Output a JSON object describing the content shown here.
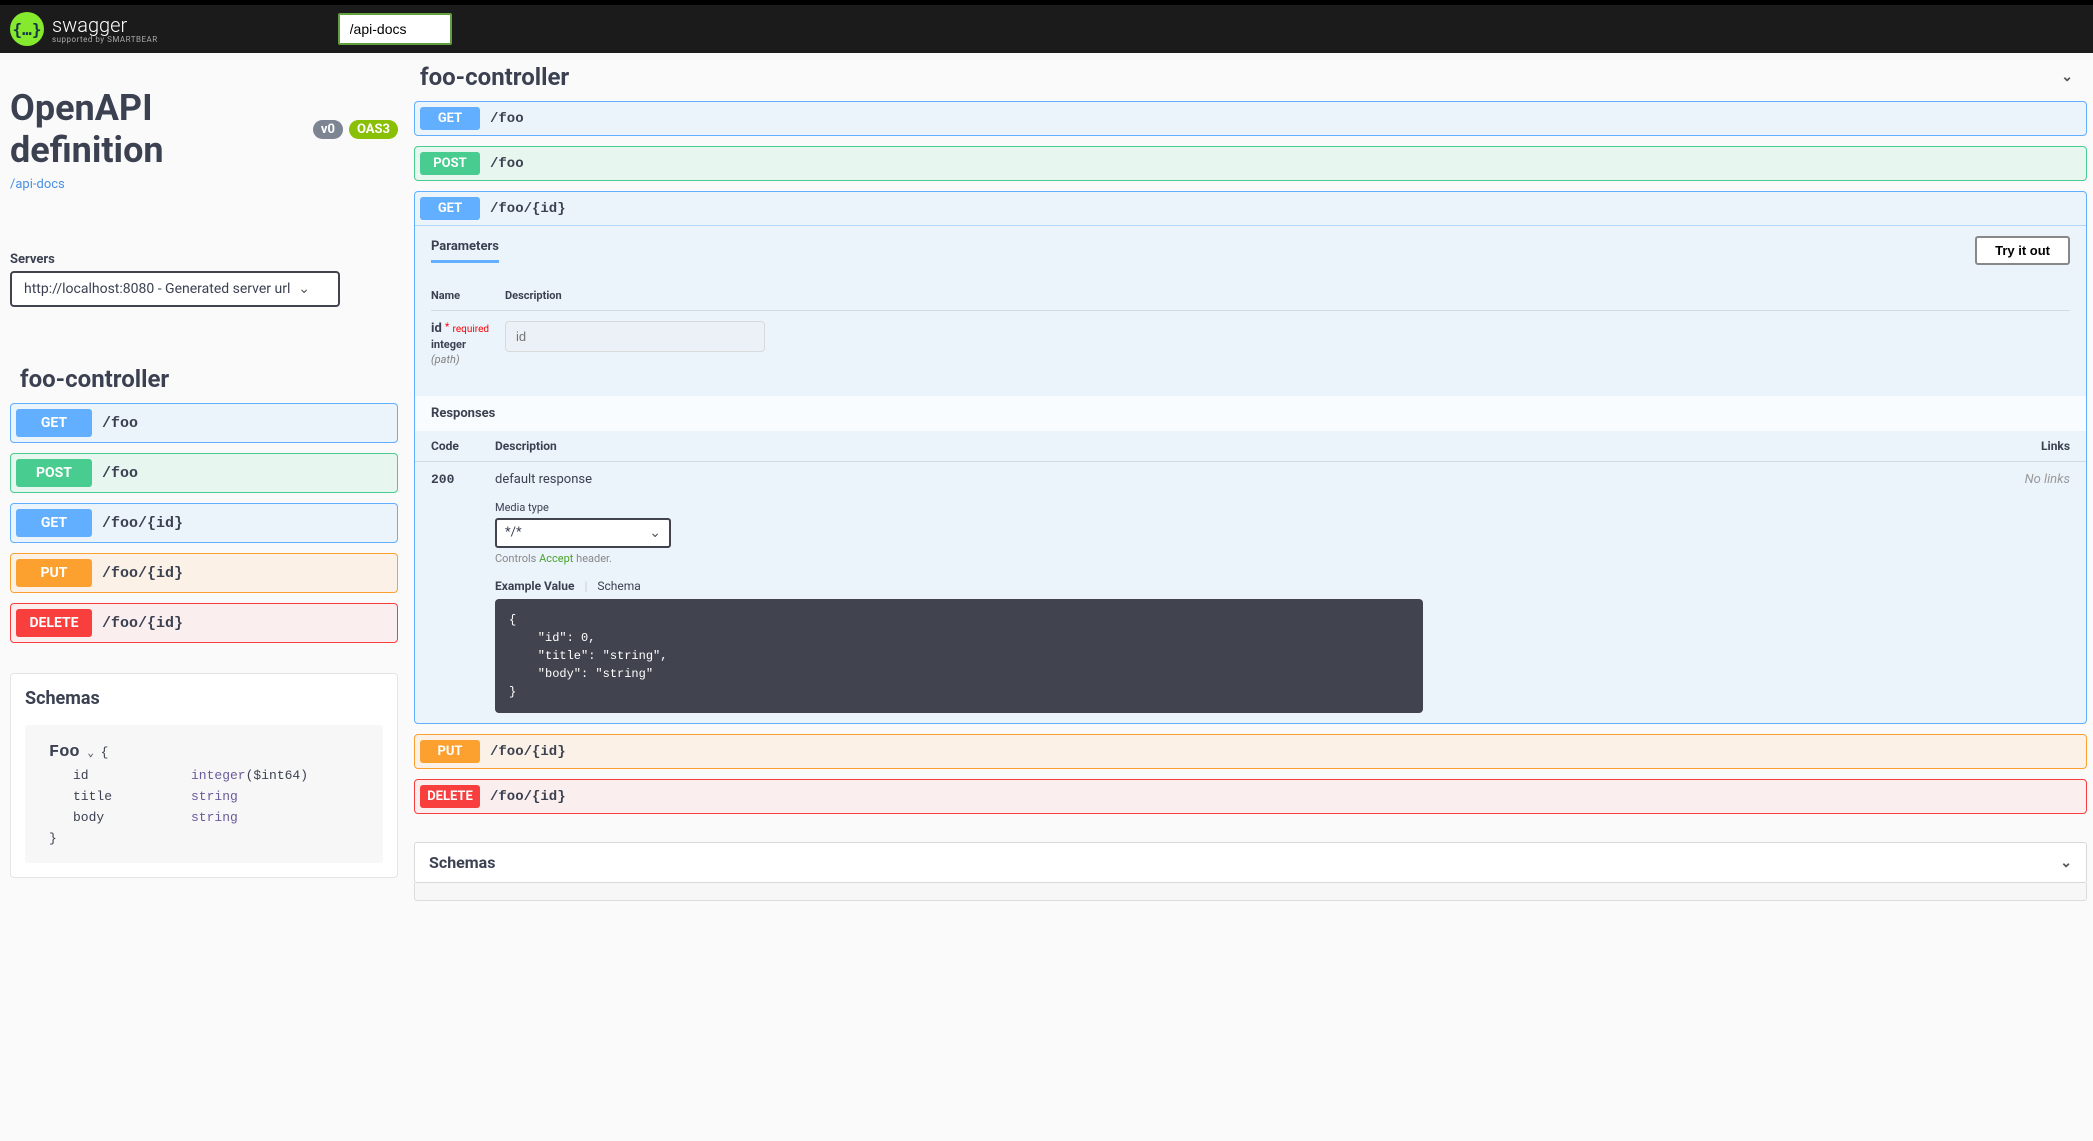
{
  "topbar": {
    "logo_glyph": "{…}",
    "logo_text": "swagger",
    "logo_subtext": "supported by SMARTBEAR",
    "url_value": "/api-docs"
  },
  "api": {
    "title": "OpenAPI definition",
    "version_badge": "v0",
    "oas_badge": "OAS3",
    "docs_link": "/api-docs"
  },
  "servers": {
    "label": "Servers",
    "selected": "http://localhost:8080 - Generated server url"
  },
  "controller": {
    "name": "foo-controller"
  },
  "left_ops": [
    {
      "method": "GET",
      "path": "/foo",
      "cls": "get"
    },
    {
      "method": "POST",
      "path": "/foo",
      "cls": "post"
    },
    {
      "method": "GET",
      "path": "/foo/{id}",
      "cls": "get"
    },
    {
      "method": "PUT",
      "path": "/foo/{id}",
      "cls": "put"
    },
    {
      "method": "DELETE",
      "path": "/foo/{id}",
      "cls": "delete"
    }
  ],
  "right_ops": {
    "r0": {
      "method": "GET",
      "path": "/foo"
    },
    "r1": {
      "method": "POST",
      "path": "/foo"
    },
    "r2": {
      "method": "GET",
      "path": "/foo/{id}"
    },
    "r3": {
      "method": "PUT",
      "path": "/foo/{id}"
    },
    "r4": {
      "method": "DELETE",
      "path": "/foo/{id}"
    }
  },
  "expanded": {
    "params_tab": "Parameters",
    "tryout": "Try it out",
    "th_name": "Name",
    "th_desc": "Description",
    "param_name": "id",
    "param_required": "required",
    "param_type": "integer",
    "param_loc": "(path)",
    "param_placeholder": "id",
    "responses_label": "Responses",
    "th_code": "Code",
    "th_desc2": "Description",
    "th_links": "Links",
    "resp_code": "200",
    "resp_desc": "default response",
    "no_links": "No links",
    "media_label": "Media type",
    "media_value": "*/*",
    "accept_hint_pre": "Controls ",
    "accept_hint_mid": "Accept",
    "accept_hint_post": " header.",
    "tab_example": "Example Value",
    "tab_schema": "Schema",
    "example_json": "{\n    \"id\": 0,\n    \"title\": \"string\",\n    \"body\": \"string\"\n}"
  },
  "schemas": {
    "title": "Schemas",
    "model_name": "Foo",
    "brace_open": "{",
    "brace_close": "}",
    "fields": {
      "f0": {
        "key": "id",
        "type": "integer",
        "format": "($int64)"
      },
      "f1": {
        "key": "title",
        "type": "string",
        "format": ""
      },
      "f2": {
        "key": "body",
        "type": "string",
        "format": ""
      }
    }
  }
}
